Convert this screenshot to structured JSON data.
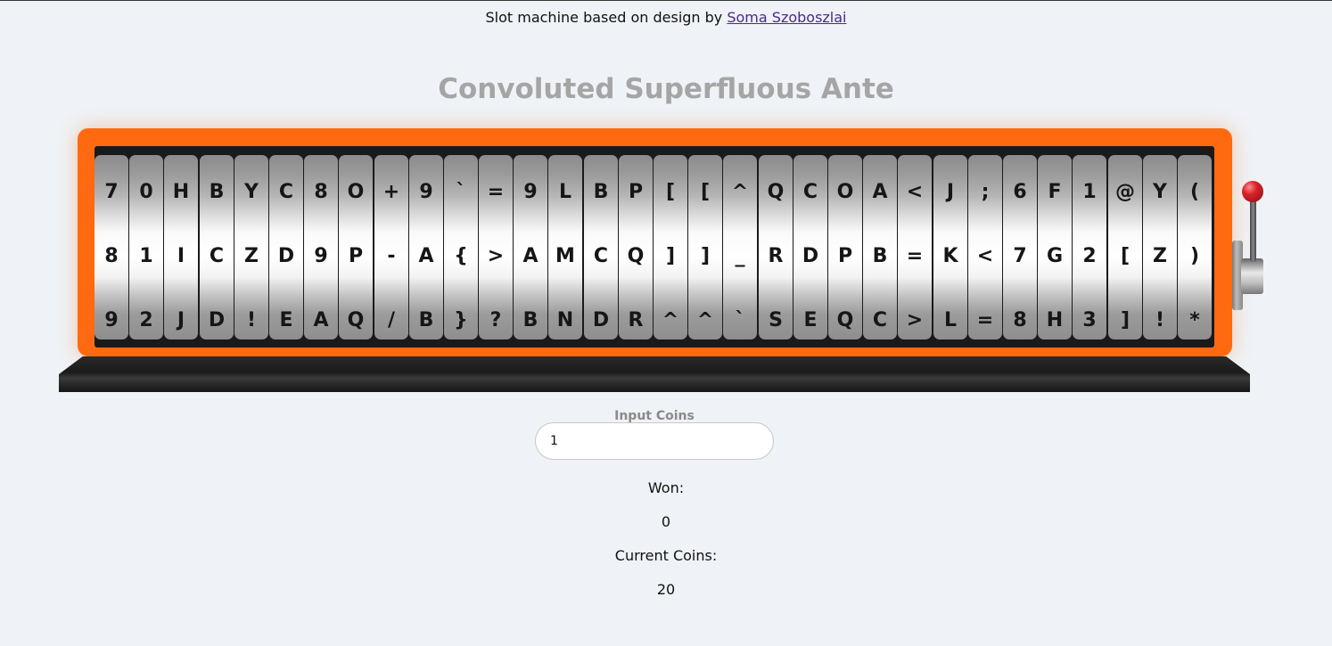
{
  "credit": {
    "prefix": "Slot machine based on design by ",
    "link": "Soma Szoboszlai"
  },
  "title": "Convoluted Superfluous Ante",
  "reels": [
    [
      "7",
      "8",
      "9"
    ],
    [
      "0",
      "1",
      "2"
    ],
    [
      "H",
      "I",
      "J"
    ],
    [
      "B",
      "C",
      "D"
    ],
    [
      "Y",
      "Z",
      "!"
    ],
    [
      "C",
      "D",
      "E"
    ],
    [
      "8",
      "9",
      "A"
    ],
    [
      "O",
      "P",
      "Q"
    ],
    [
      "+",
      "-",
      "/"
    ],
    [
      "9",
      "A",
      "B"
    ],
    [
      "`",
      "{",
      "}"
    ],
    [
      "=",
      ">",
      "?"
    ],
    [
      "9",
      "A",
      "B"
    ],
    [
      "L",
      "M",
      "N"
    ],
    [
      "B",
      "C",
      "D"
    ],
    [
      "P",
      "Q",
      "R"
    ],
    [
      "[",
      "]",
      "^"
    ],
    [
      "[",
      "]",
      "^"
    ],
    [
      "^",
      "_",
      "`"
    ],
    [
      "Q",
      "R",
      "S"
    ],
    [
      "C",
      "D",
      "E"
    ],
    [
      "O",
      "P",
      "Q"
    ],
    [
      "A",
      "B",
      "C"
    ],
    [
      "<",
      "=",
      ">"
    ],
    [
      "J",
      "K",
      "L"
    ],
    [
      ";",
      "<",
      "="
    ],
    [
      "6",
      "7",
      "8"
    ],
    [
      "F",
      "G",
      "H"
    ],
    [
      "1",
      "2",
      "3"
    ],
    [
      "@",
      "[",
      "]"
    ],
    [
      "Y",
      "Z",
      "!"
    ],
    [
      "(",
      ")",
      "*"
    ]
  ],
  "input": {
    "label": "Input Coins",
    "value": "1"
  },
  "stats": {
    "won_label": "Won:",
    "won_value": "0",
    "coins_label": "Current Coins:",
    "coins_value": "20"
  },
  "colors": {
    "cabinet": "#ff6a10",
    "title": "#a5a5a5",
    "knob": "#d8232a"
  },
  "icons": {
    "lever": "lever-icon",
    "knob": "lever-knob-icon"
  }
}
